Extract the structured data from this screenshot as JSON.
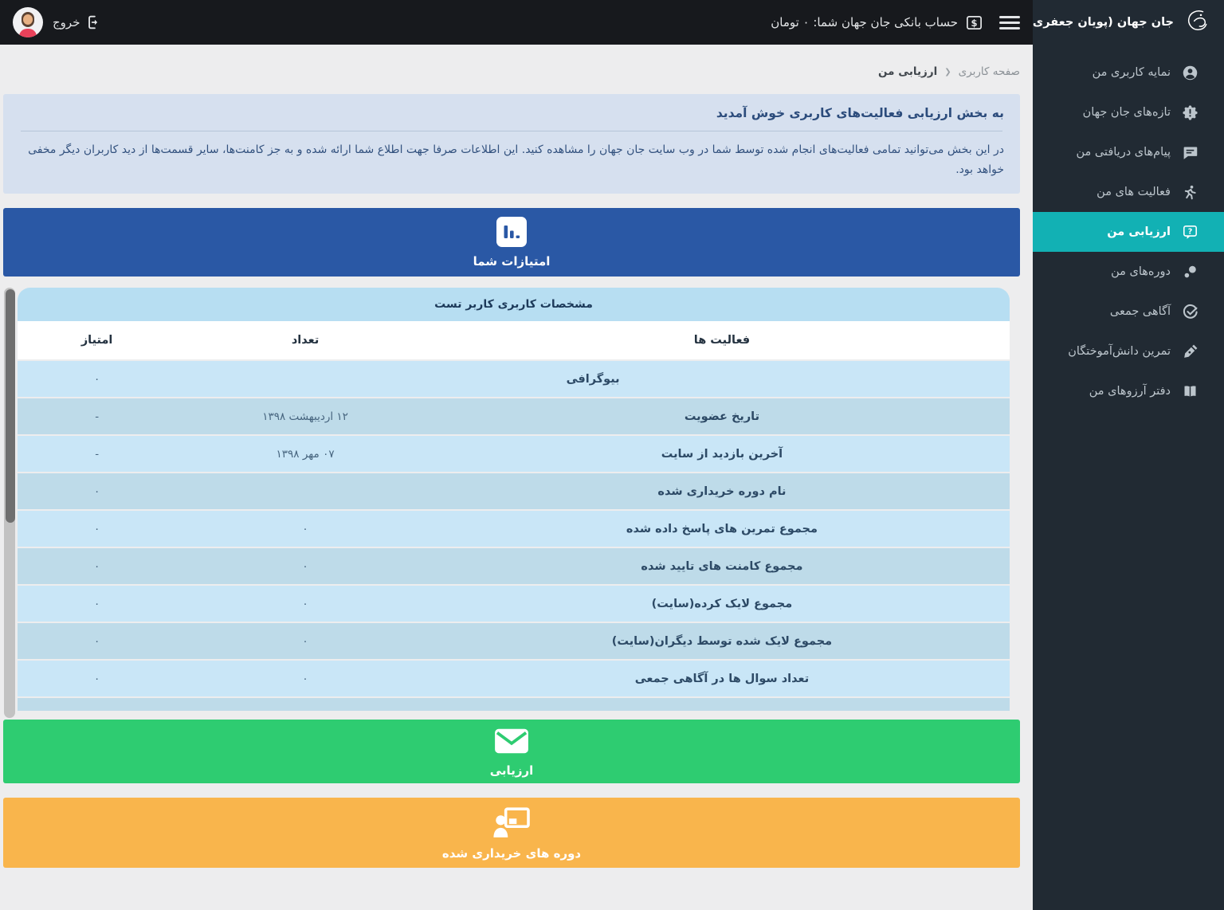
{
  "topbar": {
    "logout_label": "خروج",
    "bank_label": "حساب بانکی جان جهان شما: ۰ تومان"
  },
  "sidebar": {
    "brand": "جان جهان (پویان جعفری)",
    "items": [
      {
        "slug": "my-profile",
        "icon": "user-circle-icon",
        "label": "نمایه کاربری من",
        "active": false
      },
      {
        "slug": "jan-jahan-news",
        "icon": "badge-icon",
        "label": "تازه‌های جان جهان",
        "active": false
      },
      {
        "slug": "my-messages",
        "icon": "message-icon",
        "label": "پیام‌های دریافتی من",
        "active": false
      },
      {
        "slug": "my-activities",
        "icon": "running-icon",
        "label": "فعالیت های من",
        "active": false
      },
      {
        "slug": "my-evaluation",
        "icon": "question-bubble-icon",
        "label": "ارزیابی من",
        "active": true
      },
      {
        "slug": "my-courses",
        "icon": "dots-icon",
        "label": "دوره‌های من",
        "active": false
      },
      {
        "slug": "collective-awareness",
        "icon": "check-circle-icon",
        "label": "آگاهی جمعی",
        "active": false
      },
      {
        "slug": "alumni-practice",
        "icon": "pen-icon",
        "label": "تمرین دانش‌آموختگان",
        "active": false
      },
      {
        "slug": "my-wishbook",
        "icon": "book-icon",
        "label": "دفتر آرزوهای من",
        "active": false
      }
    ]
  },
  "breadcrumb": {
    "parent": "صفحه کاربری",
    "separator": "❮",
    "current": "ارزیابی من"
  },
  "welcome": {
    "title": "به بخش ارزیابی فعالیت‌های کاربری خوش آمدید",
    "body": "در این بخش می‌توانید تمامی فعالیت‌های انجام شده توسط شما در وب سایت جان جهان را مشاهده کنید. این اطلاعات صرفا جهت اطلاع شما ارائه شده و به جز کامنت‌ها، سایر قسمت‌ها از دید کاربران دیگر مخفی خواهد بود."
  },
  "buttons": {
    "scores": "امتیازات شما",
    "evaluation": "ارزیابی",
    "purchased_courses": "دوره های خریداری شده"
  },
  "table": {
    "title": "مشخصات کاربری کاربر تست",
    "columns": {
      "activity": "فعالیت ها",
      "count": "تعداد",
      "score": "امتیاز"
    },
    "rows": [
      {
        "activity": "بیوگرافی",
        "count": "",
        "score": "۰",
        "span": true
      },
      {
        "activity": "تاریخ عضویت",
        "count": "۱۲ اردیبهشت ۱۳۹۸",
        "score": "-",
        "span": false
      },
      {
        "activity": "آخرین بازدید از سایت",
        "count": "۰۷ مهر ۱۳۹۸",
        "score": "-",
        "span": false
      },
      {
        "activity": "نام دوره خریداری شده",
        "count": "",
        "score": "۰",
        "span": false
      },
      {
        "activity": "مجموع تمرین های پاسخ داده شده",
        "count": "۰",
        "score": "۰",
        "span": false
      },
      {
        "activity": "مجموع کامنت های تایید شده",
        "count": "۰",
        "score": "۰",
        "span": false
      },
      {
        "activity": "مجموع لایک کرده(سایت)",
        "count": "۰",
        "score": "۰",
        "span": false
      },
      {
        "activity": "مجموع لایک شده توسط دیگران(سایت)",
        "count": "۰",
        "score": "۰",
        "span": false
      },
      {
        "activity": "تعداد سوال ها در آگاهی جمعی",
        "count": "۰",
        "score": "۰",
        "span": false
      }
    ]
  },
  "colors": {
    "accent_teal": "#12b1b4",
    "primary_blue": "#2a58a5",
    "success_green": "#2ecc71",
    "warning_orange": "#f9b54c",
    "sidebar_dark": "#212a33",
    "topbar_black": "#17191d",
    "welcome_bg": "#d6e0ef",
    "table_header_bg": "#b7def2",
    "row_light": "#c9e6f7",
    "row_dark": "#bedbe9"
  }
}
